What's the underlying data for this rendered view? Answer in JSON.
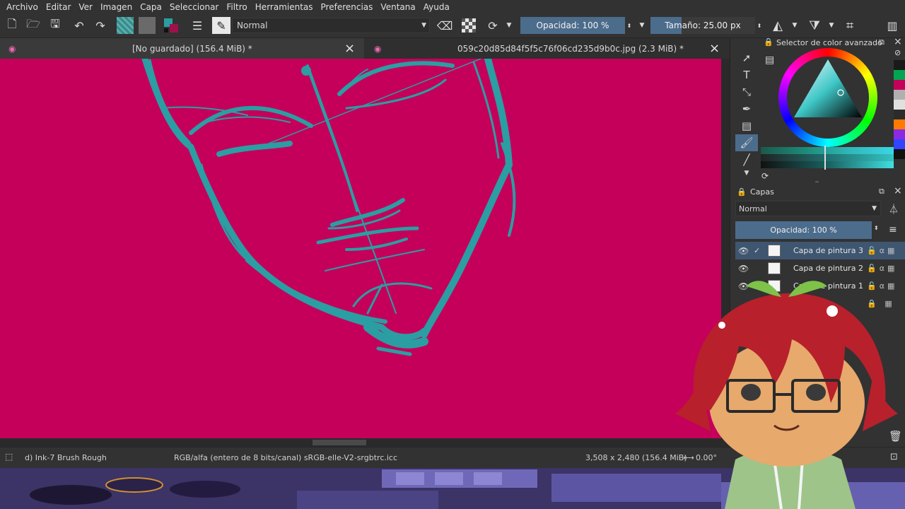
{
  "menu": [
    "Archivo",
    "Editar",
    "Ver",
    "Imagen",
    "Capa",
    "Seleccionar",
    "Filtro",
    "Herramientas",
    "Preferencias",
    "Ventana",
    "Ayuda"
  ],
  "toolbar": {
    "blend_mode": "Normal",
    "opacity": "Opacidad: 100 %",
    "size": "Tamaño: 25.00 px",
    "icons": [
      "new-document-icon",
      "open-icon",
      "save-icon",
      "undo-icon",
      "redo-icon",
      "gradient-icon",
      "pattern-icon",
      "colors-icon",
      "brush-options-icon",
      "brush-preset-icon",
      "eraser-icon",
      "alpha-lock-icon",
      "reload-icon",
      "mirror-horizontal-icon",
      "mirror-vertical-icon",
      "wrap-icon",
      "workspace-icon"
    ]
  },
  "tabs": [
    {
      "title": "[No guardado]  (156.4 MiB) *",
      "active": true
    },
    {
      "title": "059c20d85d84f5f5c76f06cd235d9b0c.jpg (2.3 MiB) *",
      "active": false
    }
  ],
  "status": {
    "brush": "d) Ink-7 Brush Rough",
    "color_space": "RGB/alfa (entero de 8 bits/canal)  sRGB-elle-V2-srgbtrc.icc",
    "image_size": "3,508 x 2,480 (156.4 MiB)",
    "rotation": "0.00°"
  },
  "color_selector": {
    "title": "Selector de color avanzado",
    "swatches": [
      "#1a1a1a",
      "#00a651",
      "#c4005a",
      "#b0b0b0",
      "#e0e0e0",
      "#2b2b2b",
      "#ff7a00",
      "#8a2be2",
      "#3344ff",
      "#111111"
    ]
  },
  "layers": {
    "title": "Capas",
    "blend_mode": "Normal",
    "opacity": "Opacidad: 100 %",
    "items": [
      {
        "name": "Capa de pintura 3",
        "selected": true
      },
      {
        "name": "Capa de pintura 2",
        "selected": false
      },
      {
        "name": "Capa de pintura 1",
        "selected": false
      }
    ]
  },
  "colors": {
    "canvas": "#c4005a",
    "stroke": "#2a9ea3",
    "accent": "#4c6c8c"
  }
}
